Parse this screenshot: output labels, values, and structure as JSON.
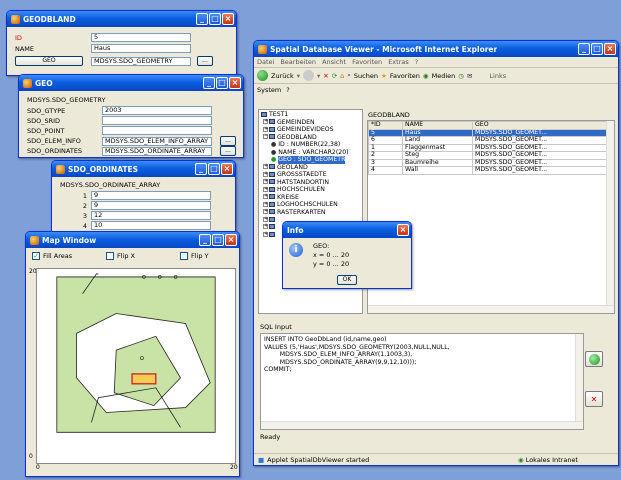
{
  "geodbland_window": {
    "title": "GEODBLAND",
    "id_label": "ID",
    "id_value": "5",
    "name_label": "NAME",
    "name_value": "Haus",
    "geo_button": "GEO",
    "geo_value": "MDSYS.SDO_GEOMETRY",
    "more_button": "..."
  },
  "geo_window": {
    "title": "GEO",
    "type_label": "MDSYS.SDO_GEOMETRY",
    "fields": [
      {
        "label": "SDO_GTYPE",
        "value": "2003"
      },
      {
        "label": "SDO_SRID",
        "value": ""
      },
      {
        "label": "SDO_POINT",
        "value": ""
      },
      {
        "label": "SDO_ELEM_INFO",
        "value": "MDSYS.SDO_ELEM_INFO_ARRAY"
      },
      {
        "label": "SDO_ORDINATES",
        "value": "MDSYS.SDO_ORDINATE_ARRAY"
      }
    ],
    "more_button": "..."
  },
  "ordinates_window": {
    "title": "SDO_ORDINATES",
    "type_label": "MDSYS.SDO_ORDINATE_ARRAY",
    "items": [
      {
        "index": "1",
        "value": "9"
      },
      {
        "index": "2",
        "value": "9"
      },
      {
        "index": "3",
        "value": "12"
      },
      {
        "index": "4",
        "value": "10"
      }
    ]
  },
  "map_window": {
    "title": "Map Window",
    "fill_areas": "Fill Areas",
    "flip_x": "Flip X",
    "flip_y": "Flip Y",
    "y_max": "20",
    "y_min": "0",
    "x_min": "0",
    "x_max": "20"
  },
  "ie_window": {
    "title": "Spatial Database Viewer - Microsoft Internet Explorer",
    "menu": [
      "Datei",
      "Bearbeiten",
      "Ansicht",
      "Favoriten",
      "Extras",
      "?"
    ],
    "toolbar": {
      "back": "Zurück",
      "search": "Suchen",
      "favorites": "Favoriten",
      "media": "Medien",
      "links": "Links"
    },
    "applet_menu": [
      "System",
      "?"
    ],
    "tree": {
      "root": "TEST1",
      "items": [
        "GEMEINDEN",
        "GEMEINDEVIDEOS",
        "GEODBLAND"
      ],
      "columns": [
        "ID : NUMBER(22,38)",
        "NAME : VARCHAR2(20)",
        "GEO : SDO_GEOMETR"
      ],
      "more": [
        "GEOLAND",
        "GROSSSTAEDTE",
        "HATSTANDORTIN",
        "HOCHSCHULEN",
        "KREISE",
        "LOGHOCHSCHULEN",
        "RASTERKARTEN"
      ]
    },
    "table": {
      "title": "GEODBLAND",
      "headers": [
        "*ID",
        "NAME",
        "GEO"
      ],
      "rows": [
        {
          "id": "5",
          "name": "Haus",
          "geo": "MDSYS.SDO_GEOMET..."
        },
        {
          "id": "6",
          "name": "Land",
          "geo": "MDSYS.SDO_GEOMET..."
        },
        {
          "id": "1",
          "name": "Flaggenmast",
          "geo": "MDSYS.SDO_GEOMET..."
        },
        {
          "id": "2",
          "name": "Steg",
          "geo": "MDSYS.SDO_GEOMET..."
        },
        {
          "id": "3",
          "name": "Baumreihe",
          "geo": "MDSYS.SDO_GEOMET..."
        },
        {
          "id": "4",
          "name": "Wall",
          "geo": "MDSYS.SDO_GEOMET..."
        }
      ]
    },
    "sql_label": "SQL Input",
    "sql_lines": [
      "INSERT INTO GeoDbLand (id,name,geo)",
      "VALUES (5,'Haus',MDSYS.SDO_GEOMETRY(2003,NULL,NULL,",
      "        MDSYS.SDO_ELEM_INFO_ARRAY(1,1003,3),",
      "        MDSYS.SDO_ORDINATE_ARRAY(9,9,12,10)));",
      "COMMIT;"
    ],
    "ready": "Ready",
    "status_left": "Applet SpatialDbViewer started",
    "status_right": "Lokales Intranet"
  },
  "info_dialog": {
    "title": "Info",
    "lines": [
      "GEO:",
      "x = 0 ... 20",
      "y = 0 ... 20"
    ],
    "ok": "OK"
  }
}
